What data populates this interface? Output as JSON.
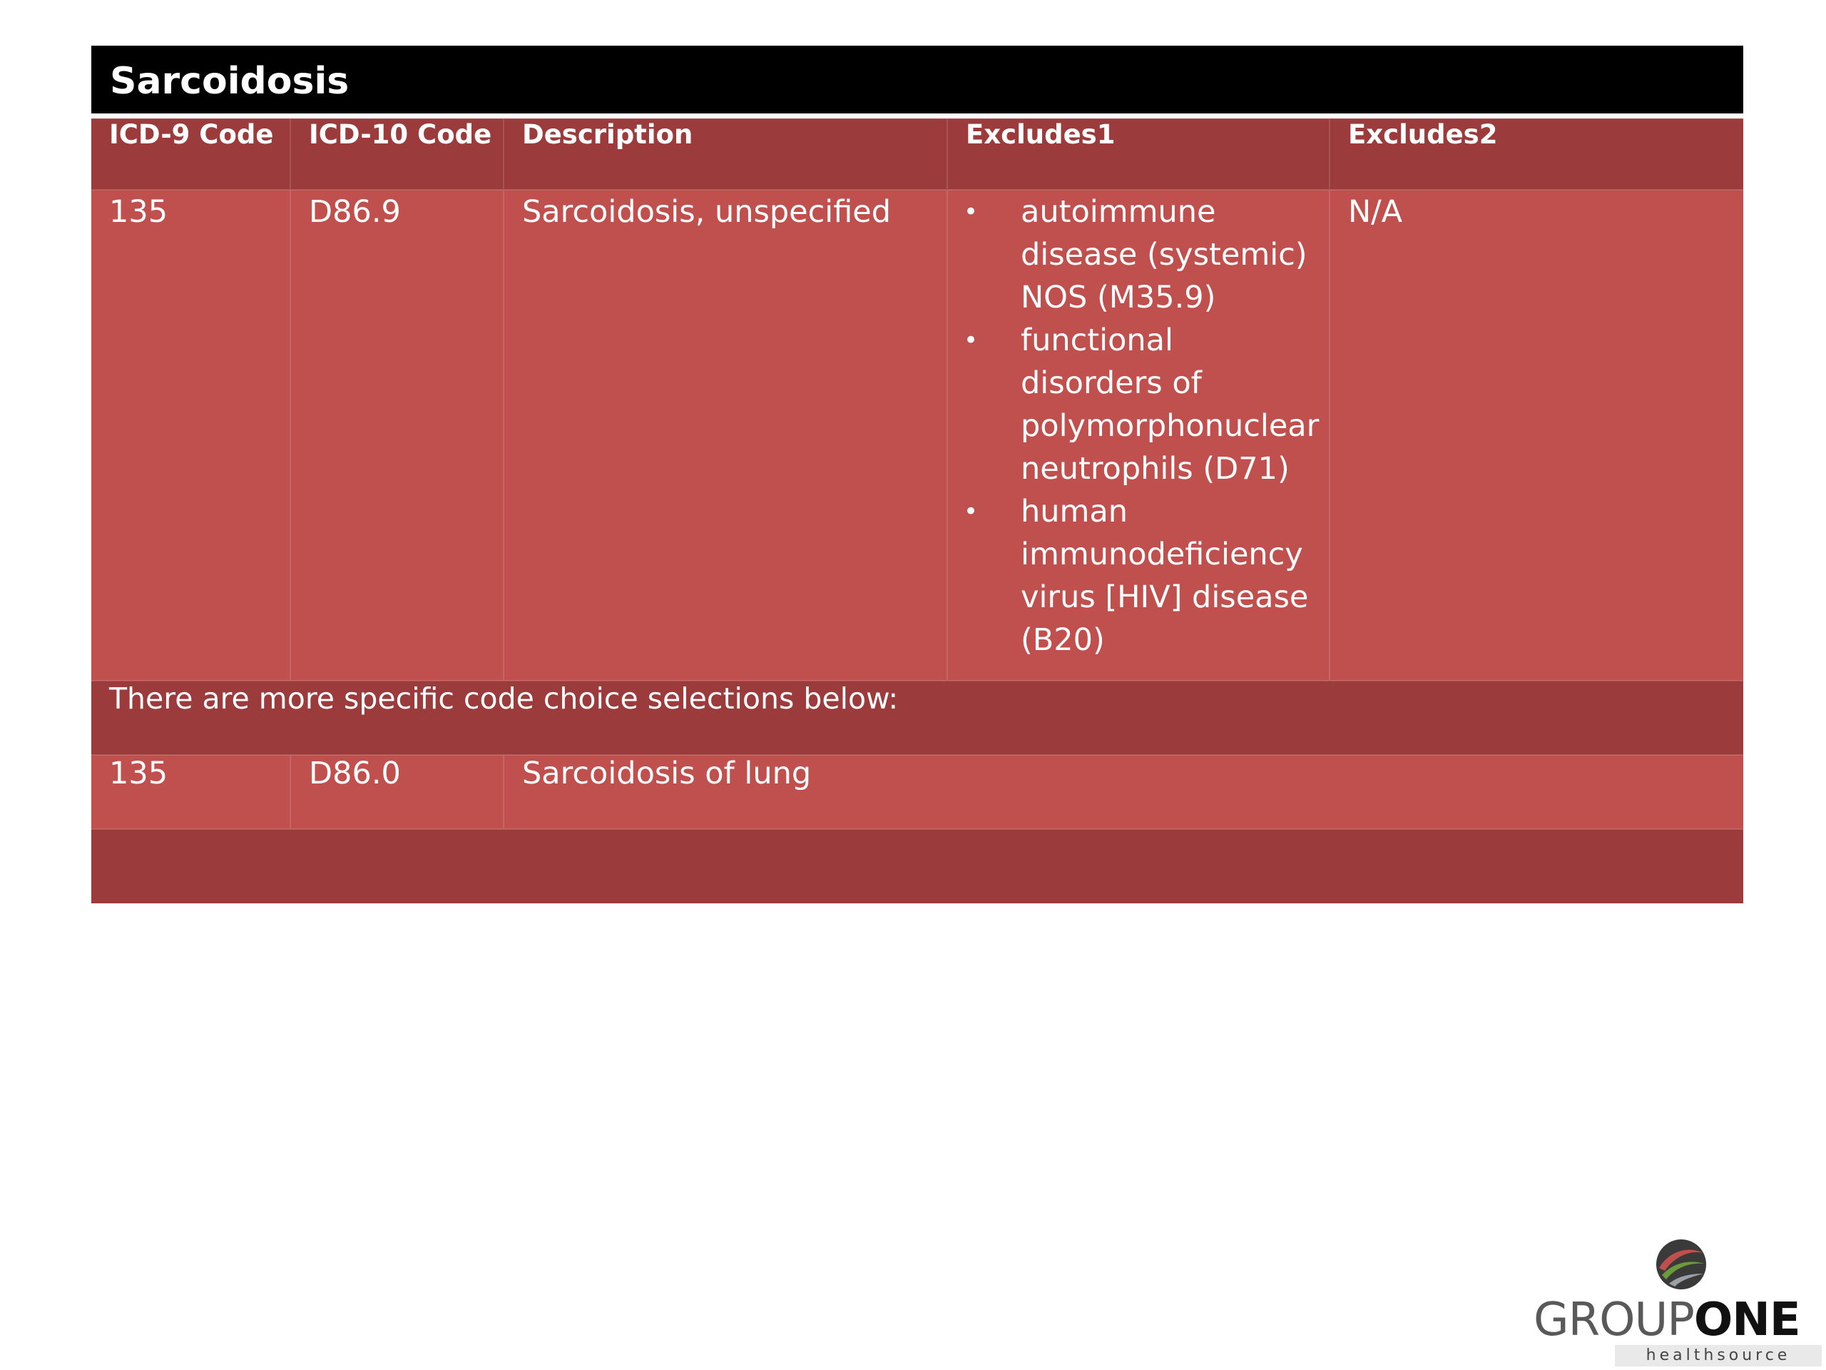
{
  "title": "Sarcoidosis",
  "columns": [
    "ICD-9 Code",
    "ICD-10 Code",
    "Description",
    "Excludes1",
    "Excludes2"
  ],
  "main_row": {
    "icd9": "135",
    "icd10": "D86.9",
    "description": "Sarcoidosis, unspecified",
    "excludes1": [
      "autoimmune disease (systemic) NOS (M35.9)",
      "functional disorders of polymorphonuclear neutrophils (D71)",
      "human immunodeficiency virus [HIV] disease (B20)"
    ],
    "excludes2": "N/A"
  },
  "note": "There are more specific code choice selections below:",
  "specific_row": {
    "icd9": "135",
    "icd10": "D86.0",
    "description": "Sarcoidosis of lung"
  },
  "logo": {
    "word_light": "GROUP",
    "word_bold": "ONE",
    "tagline": "healthsource"
  },
  "colors": {
    "header_bg": "#000000",
    "dark_red": "#9b3b3c",
    "red": "#c0504d"
  }
}
